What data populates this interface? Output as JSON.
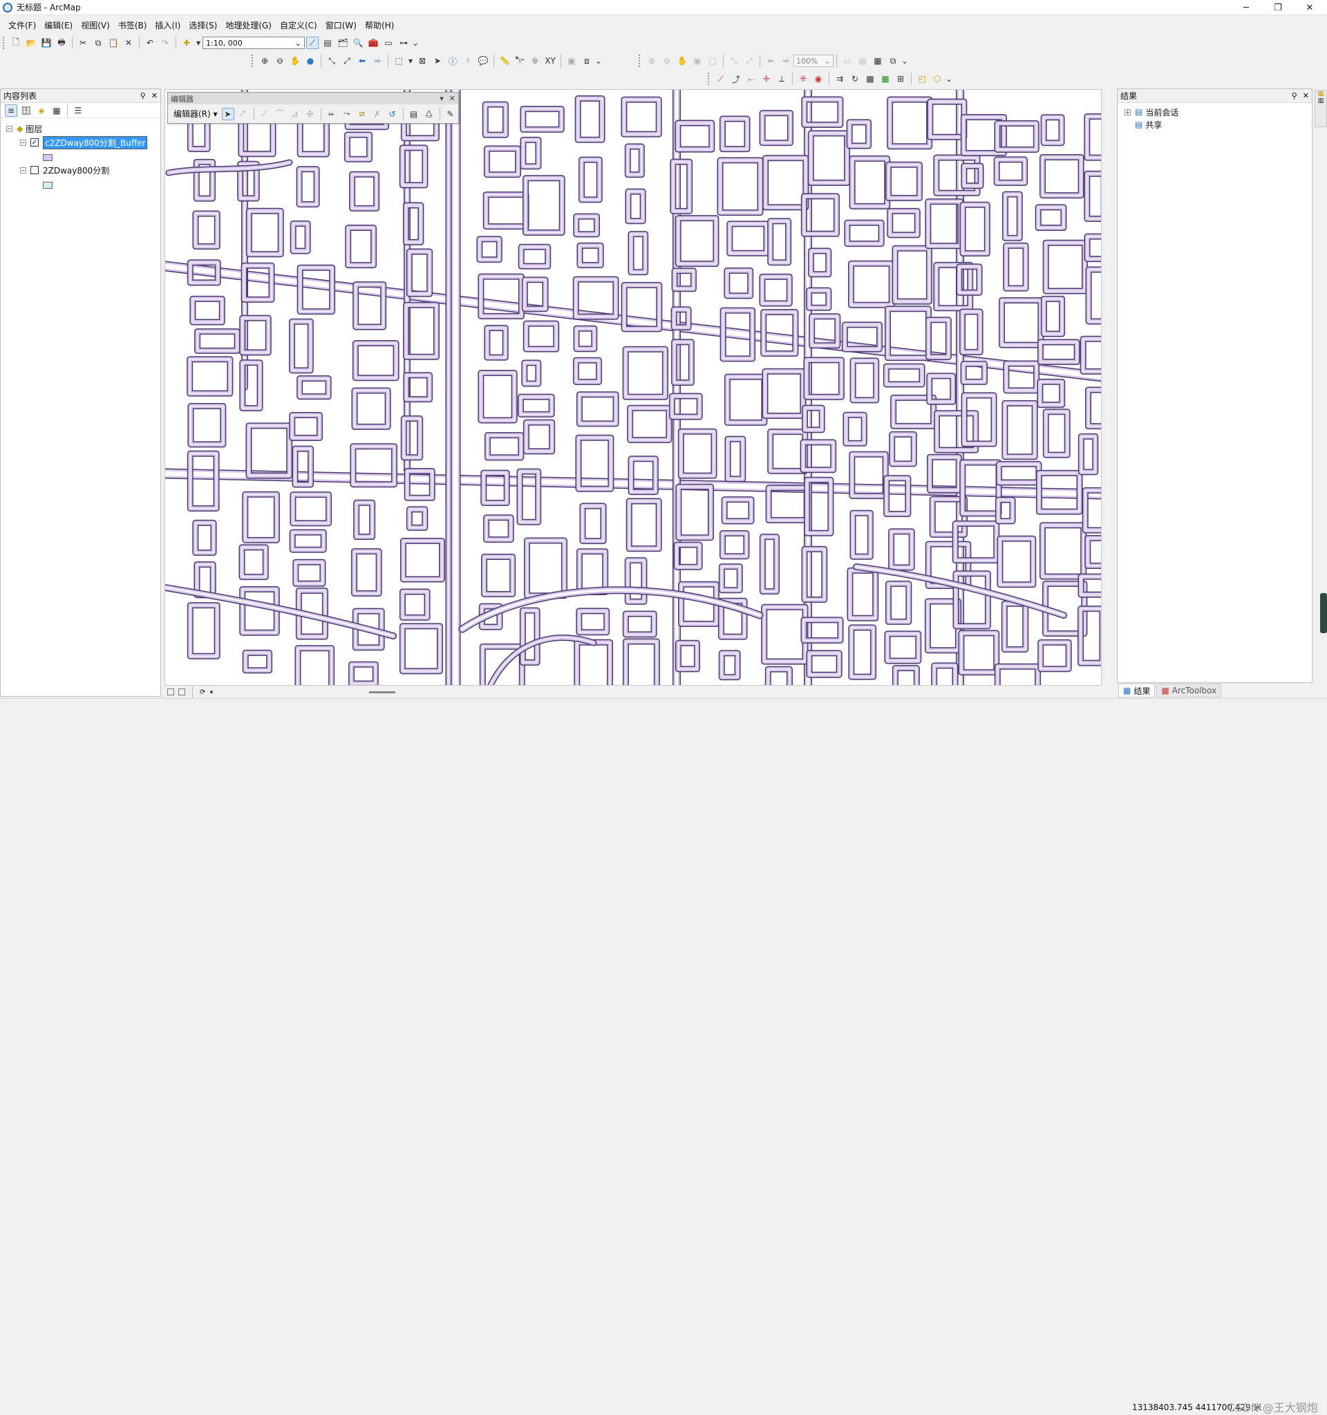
{
  "window": {
    "title": "无标题 - ArcMap",
    "minimize": "─",
    "maximize": "❐",
    "close": "✕"
  },
  "menu": [
    "文件(F)",
    "编辑(E)",
    "视图(V)",
    "书签(B)",
    "插入(I)",
    "选择(S)",
    "地理处理(G)",
    "自定义(C)",
    "窗口(W)",
    "帮助(H)"
  ],
  "toolbar": {
    "scale": "1:10, 000",
    "zoom": "100%"
  },
  "toc": {
    "title": "内容列表",
    "group": "图层",
    "layers": [
      {
        "name": "c2ZDway800分割_Buffer",
        "checked": true,
        "swatch": "#d9c6ee"
      },
      {
        "name": "2ZDway800分割",
        "checked": false,
        "swatch": "#d4eef7"
      }
    ]
  },
  "editor": {
    "title": "编辑器",
    "dropdown": "编辑器(R)"
  },
  "results": {
    "title": "结果",
    "items": [
      "当前会话",
      "共享"
    ],
    "tabs": [
      "结果",
      "ArcToolbox"
    ]
  },
  "status": {
    "coords": "13138403.745  4411700.429 米",
    "watermark": "CSDN @王大钢炮"
  },
  "colors": {
    "road_fill": "#d8c8ec",
    "road_outline": "#4a3b6e",
    "selection": "#3399ff"
  }
}
